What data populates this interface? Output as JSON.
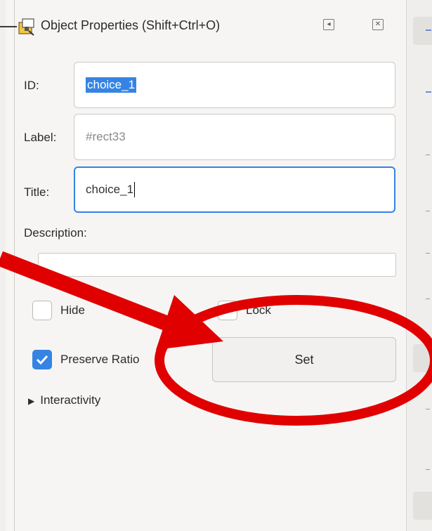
{
  "dialog": {
    "title": "Object Properties (Shift+Ctrl+O)",
    "dock_icon": "dock-icon",
    "close_icon": "close-icon"
  },
  "form": {
    "id_label": "ID:",
    "id_value": "choice_1",
    "label_label": "Label:",
    "label_placeholder": "#rect33",
    "title_label": "Title:",
    "title_value": "choice_1",
    "description_label": "Description:",
    "description_value": ""
  },
  "checks": {
    "hide_label": "Hide",
    "hide_checked": false,
    "lock_label": "Lock",
    "lock_checked": false,
    "preserve_label": "Preserve Ratio",
    "preserve_checked": true
  },
  "set_button": "Set",
  "interactivity_label": "Interactivity",
  "annotation": {
    "color": "#e00000",
    "type": "arrow-and-circle"
  },
  "colors": {
    "accent": "#3584e4"
  }
}
